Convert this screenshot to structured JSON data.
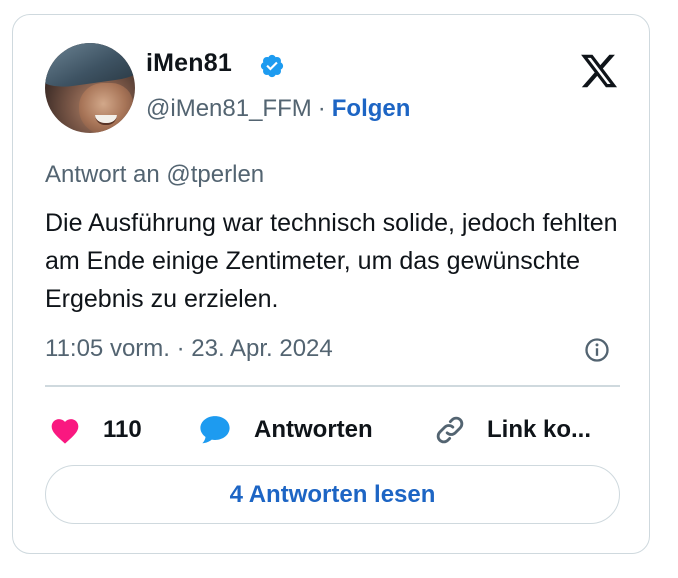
{
  "author": {
    "display_name": "iMen81",
    "handle": "@iMen81_FFM",
    "separator": "·",
    "follow_label": "Folgen",
    "verified": true
  },
  "tweet": {
    "reply_to": "Antwort an @tperlen",
    "text": "Die Ausführung war technisch solide, jedoch fehlten am Ende einige Zentimeter, um das gewünschte Ergebnis zu erzielen.",
    "timestamp": "11:05 vorm. · 23. Apr. 2024"
  },
  "actions": {
    "like_count": "110",
    "reply_label": "Antworten",
    "copy_link_label": "Link ko..."
  },
  "read_replies_label": "4 Antworten lesen",
  "icons": {
    "brand": "x-logo-icon",
    "verified": "verified-badge-icon",
    "info": "info-icon",
    "like": "heart-icon",
    "reply": "speech-bubble-icon",
    "link": "link-icon"
  },
  "colors": {
    "accent_blue": "#1d65c4",
    "verified_blue": "#1d9bf0",
    "heart_pink": "#f91880",
    "reply_blue": "#1d9bf0",
    "muted_text": "#536471",
    "border": "#cfd9de"
  }
}
